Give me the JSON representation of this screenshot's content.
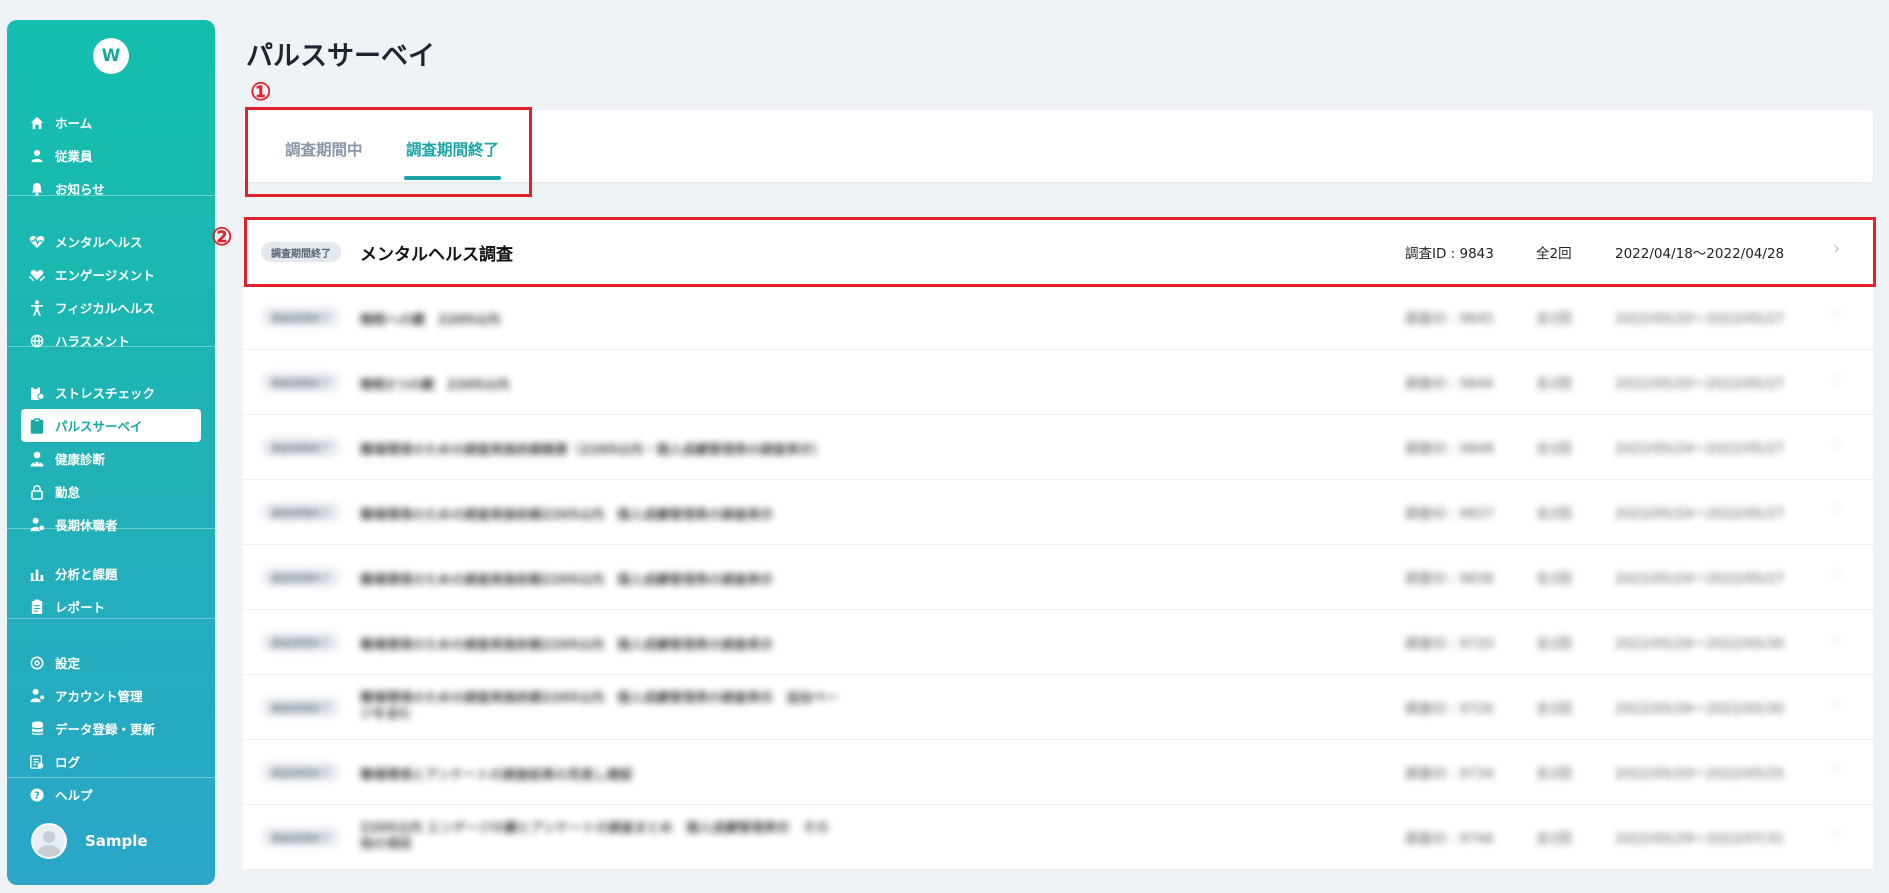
{
  "sidebar": {
    "logo": "W",
    "groups": [
      [
        {
          "label": "ホーム",
          "icon": "home-icon"
        },
        {
          "label": "従業員",
          "icon": "person-icon"
        },
        {
          "label": "お知らせ",
          "icon": "bell-icon"
        }
      ],
      [
        {
          "label": "メンタルヘルス",
          "icon": "heart-pulse-icon"
        },
        {
          "label": "エンゲージメント",
          "icon": "heart-hands-icon"
        },
        {
          "label": "フィジカルヘルス",
          "icon": "figure-icon"
        },
        {
          "label": "ハラスメント",
          "icon": "globe-icon"
        }
      ],
      [
        {
          "label": "ストレスチェック",
          "icon": "clipboard-check-icon"
        },
        {
          "label": "パルスサーベイ",
          "icon": "pulse-clipboard-icon",
          "active": true
        },
        {
          "label": "健康診断",
          "icon": "doctor-icon"
        },
        {
          "label": "勤怠",
          "icon": "lock-icon"
        },
        {
          "label": "長期休職者",
          "icon": "person-away-icon"
        }
      ],
      [
        {
          "label": "分析と課題",
          "icon": "bar-chart-icon"
        },
        {
          "label": "レポート",
          "icon": "report-icon"
        }
      ],
      [
        {
          "label": "設定",
          "icon": "settings-icon"
        },
        {
          "label": "アカウント管理",
          "icon": "account-icon"
        },
        {
          "label": "データ登録・更新",
          "icon": "database-icon"
        },
        {
          "label": "ログ",
          "icon": "log-icon"
        },
        {
          "label": "ヘルプ",
          "icon": "help-icon"
        }
      ]
    ],
    "user_name": "Sample"
  },
  "page": {
    "title": "パルスサーベイ",
    "annotation_1": "①",
    "annotation_2": "②"
  },
  "tabs": {
    "inactive": "調査期間中",
    "active": "調査期間終了"
  },
  "list": {
    "rows": [
      {
        "badge": "調査期間終了",
        "title": "メンタルヘルス調査",
        "id": "調査ID : 9843",
        "times": "全2回",
        "period": "2022/04/18〜2022/04/28",
        "blurred": false
      },
      {
        "badge": "調査期間終了",
        "title": "睡眠への鍵　2205以内",
        "id": "調査ID : 9845",
        "times": "全2回",
        "period": "2022/05/20〜2022/05/27",
        "blurred": true
      },
      {
        "badge": "調査期間終了",
        "title": "睡眠2つの鍵　2205以内",
        "id": "調査ID : 9846",
        "times": "全2回",
        "period": "2022/05/20〜2022/05/27",
        "blurred": true
      },
      {
        "badge": "調査期間終了",
        "title": "職場環境のための調査実施依頼概要（2205以内・個人成績管理表の調査表示）",
        "id": "調査ID : 9848",
        "times": "全2回",
        "period": "2022/05/24〜2022/05/27",
        "blurred": true
      },
      {
        "badge": "調査期間終了",
        "title": "職場環境のための調査実施依頼2205以内　個人成績管理表の調査表示",
        "id": "調査ID : 9837",
        "times": "全2回",
        "period": "2022/05/24〜2022/05/27",
        "blurred": true
      },
      {
        "badge": "調査期間終了",
        "title": "職場環境のための調査実施依頼2205以内　個人成績管理表の調査表示",
        "id": "調査ID : 9838",
        "times": "全2回",
        "period": "2022/05/24〜2022/05/27",
        "blurred": true
      },
      {
        "badge": "調査期間終了",
        "title": "職場環境のための調査実施依頼2205以内　個人成績管理表の調査表示",
        "id": "調査ID : 9720",
        "times": "全2回",
        "period": "2022/05/26〜2022/05/30",
        "blurred": true
      },
      {
        "badge": "調査期間終了",
        "title": "職場環境のための調査実施依頼2205以内　個人成績管理表の調査表示　追加ページを含む",
        "id": "調査ID : 9726",
        "times": "全2回",
        "period": "2022/05/26〜2022/05/30",
        "blurred": true,
        "two_line": true
      },
      {
        "badge": "調査期間終了",
        "title": "職場環境とアンケートの調査結果の見直し確認",
        "id": "調査ID : 9734",
        "times": "全2回",
        "period": "2022/05/20〜2022/05/25",
        "blurred": true
      },
      {
        "badge": "調査期間終了",
        "title": "2205以内 エンゲージの鍵とアンケートの調査まとめ　個人成績管理表示　その他の項目",
        "id": "調査ID : 9746",
        "times": "全2回",
        "period": "2022/05/29〜2022/07/31",
        "blurred": true,
        "two_line": true
      }
    ]
  },
  "colors": {
    "accent": "#1aa6a8",
    "annotation_red": "#e0202a",
    "sidebar_top": "#14bfae",
    "sidebar_bottom": "#29a6c8"
  }
}
